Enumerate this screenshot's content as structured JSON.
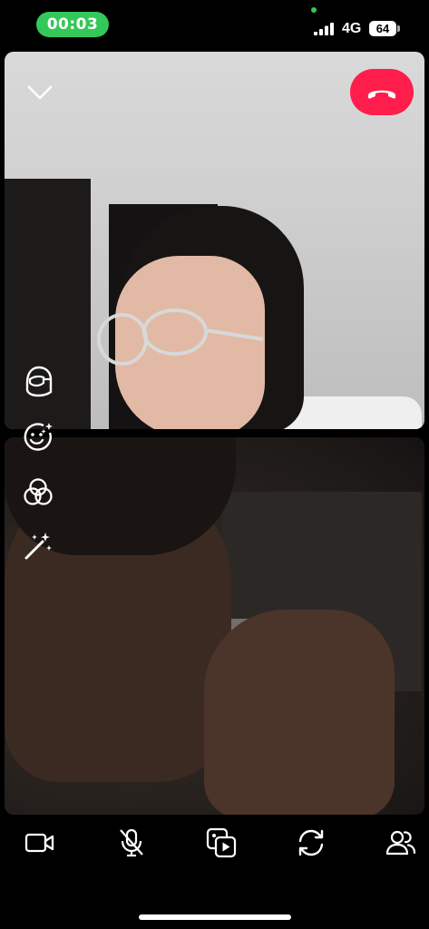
{
  "status_bar": {
    "call_timer": "00:03",
    "network": "4G",
    "battery": "64",
    "signal_icon": "cellular-signal-icon"
  },
  "call": {
    "collapse_icon": "chevron-down-icon",
    "end_call_icon": "hang-up-phone-icon",
    "end_call_color": "#ff1e4b",
    "timer_color": "#34c759"
  },
  "effects": [
    {
      "icon": "face-mask-icon"
    },
    {
      "icon": "sparkle-face-icon"
    },
    {
      "icon": "filters-icon"
    },
    {
      "icon": "magic-wand-icon"
    }
  ],
  "toolbar": [
    {
      "icon": "video-camera-icon"
    },
    {
      "icon": "microphone-muted-icon"
    },
    {
      "icon": "media-share-icon"
    },
    {
      "icon": "flip-camera-icon"
    },
    {
      "icon": "participants-icon"
    }
  ]
}
